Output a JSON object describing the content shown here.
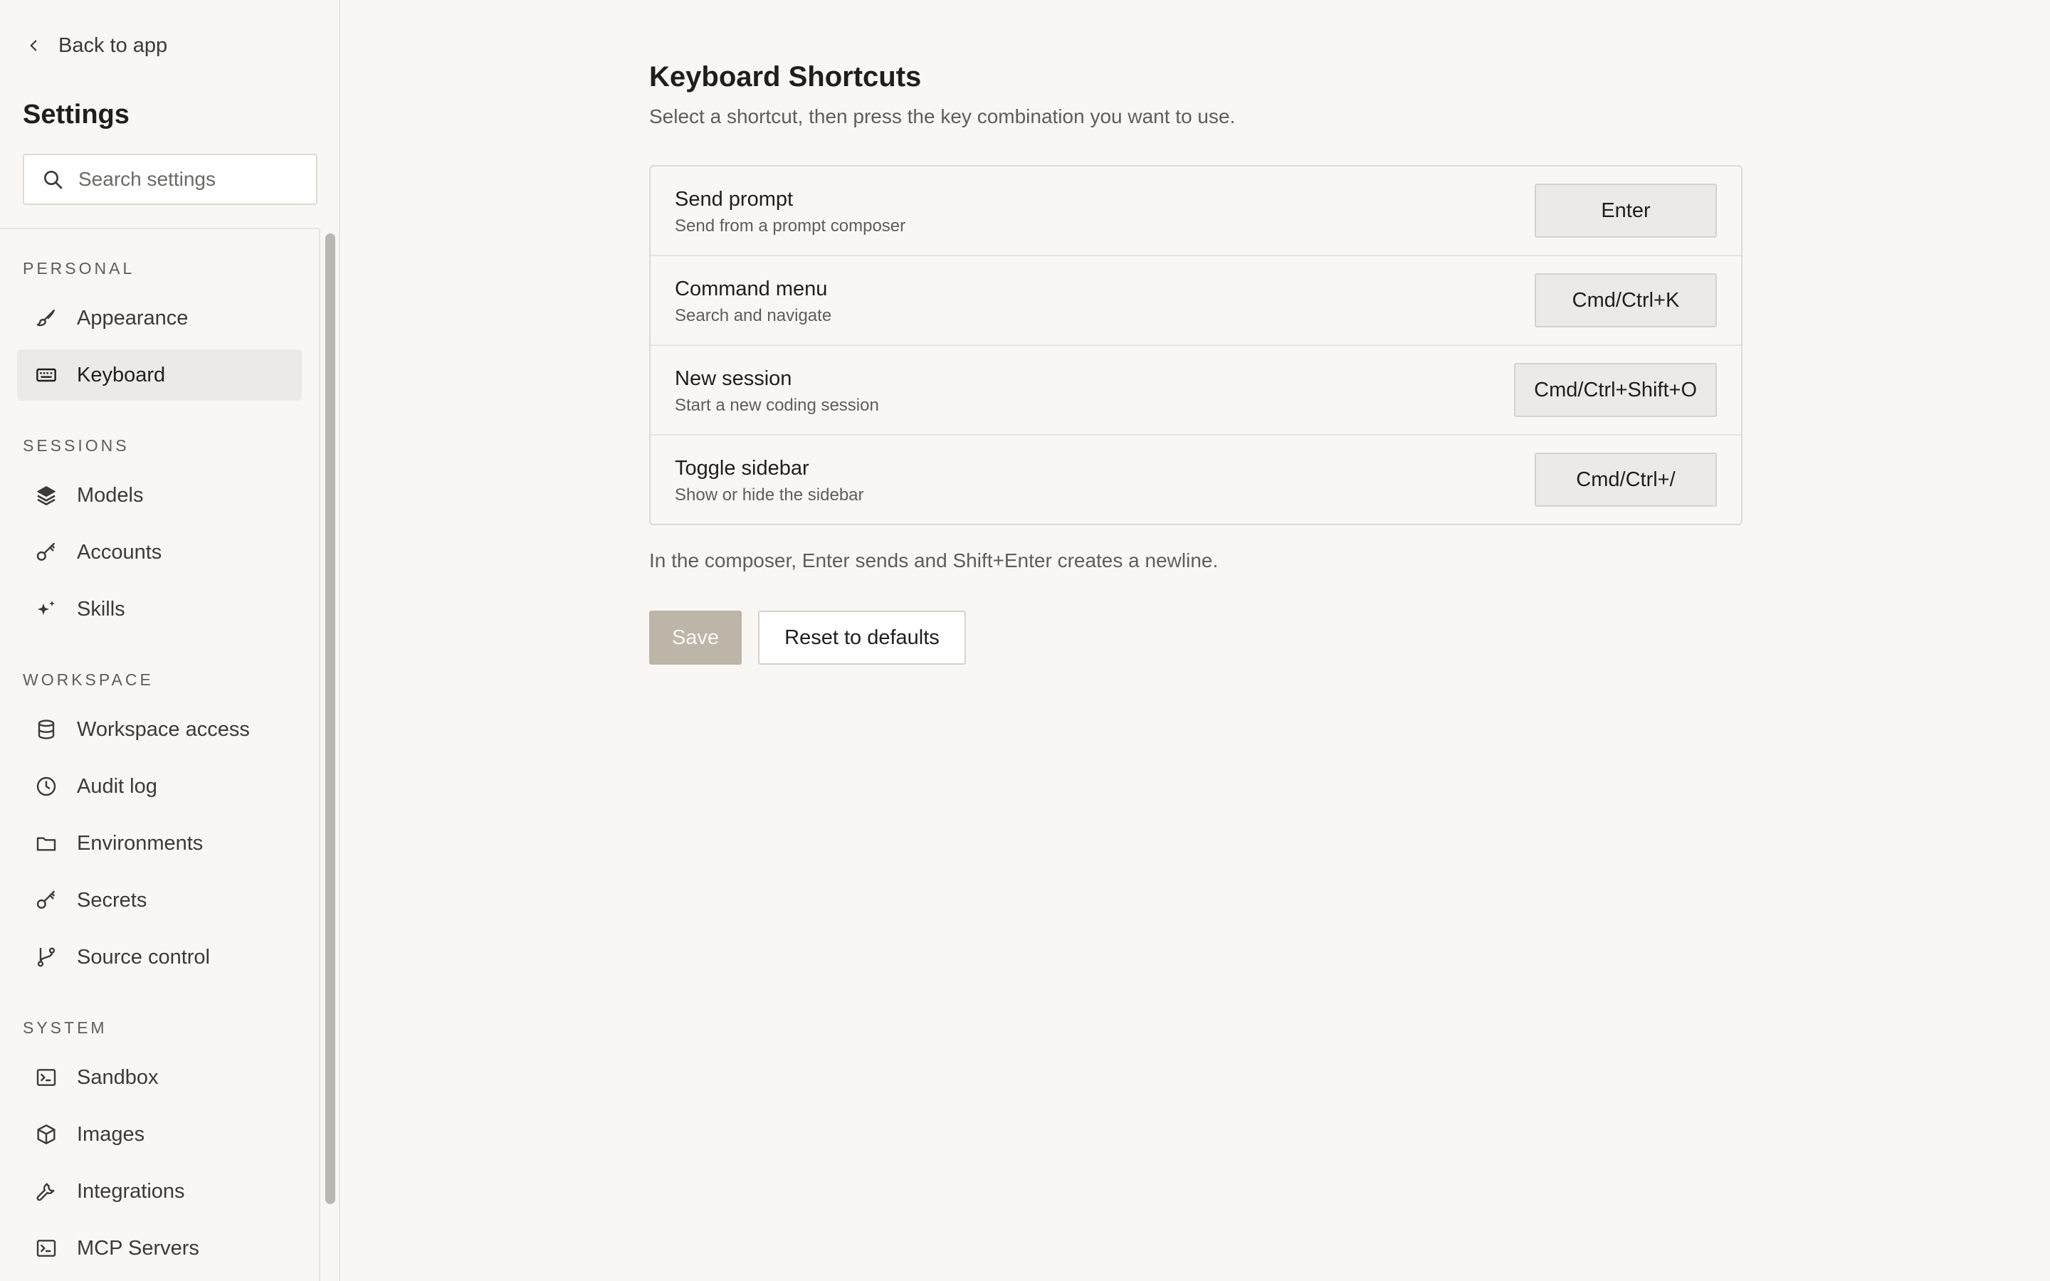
{
  "sidebar": {
    "back_label": "Back to app",
    "title": "Settings",
    "search_placeholder": "Search settings",
    "sections": {
      "personal": {
        "label": "PERSONAL",
        "items": [
          {
            "label": "Appearance",
            "icon": "brush-icon"
          },
          {
            "label": "Keyboard",
            "icon": "keyboard-icon",
            "active": true
          }
        ]
      },
      "sessions": {
        "label": "SESSIONS",
        "items": [
          {
            "label": "Models",
            "icon": "layers-icon"
          },
          {
            "label": "Accounts",
            "icon": "key-icon"
          },
          {
            "label": "Skills",
            "icon": "sparkle-icon"
          }
        ]
      },
      "workspace": {
        "label": "WORKSPACE",
        "items": [
          {
            "label": "Workspace access",
            "icon": "database-icon"
          },
          {
            "label": "Audit log",
            "icon": "clock-icon"
          },
          {
            "label": "Environments",
            "icon": "folder-icon"
          },
          {
            "label": "Secrets",
            "icon": "key-icon"
          },
          {
            "label": "Source control",
            "icon": "git-branch-icon"
          }
        ]
      },
      "system": {
        "label": "SYSTEM",
        "items": [
          {
            "label": "Sandbox",
            "icon": "terminal-icon"
          },
          {
            "label": "Images",
            "icon": "cube-icon"
          },
          {
            "label": "Integrations",
            "icon": "wrench-icon"
          },
          {
            "label": "MCP Servers",
            "icon": "terminal-icon"
          }
        ]
      }
    }
  },
  "main": {
    "title": "Keyboard Shortcuts",
    "subtitle": "Select a shortcut, then press the key combination you want to use.",
    "shortcuts": [
      {
        "label": "Send prompt",
        "description": "Send from a prompt composer",
        "key": "Enter"
      },
      {
        "label": "Command menu",
        "description": "Search and navigate",
        "key": "Cmd/Ctrl+K"
      },
      {
        "label": "New session",
        "description": "Start a new coding session",
        "key": "Cmd/Ctrl+Shift+O"
      },
      {
        "label": "Toggle sidebar",
        "description": "Show or hide the sidebar",
        "key": "Cmd/Ctrl+/"
      }
    ],
    "composer_note": "In the composer, Enter sends and Shift+Enter creates a newline.",
    "save_label": "Save",
    "reset_label": "Reset to defaults"
  },
  "colors": {
    "background": "#f8f7f4",
    "active_item": "#ebeae6",
    "save_disabled": "#bdb5a8",
    "border": "#dcdad4"
  }
}
